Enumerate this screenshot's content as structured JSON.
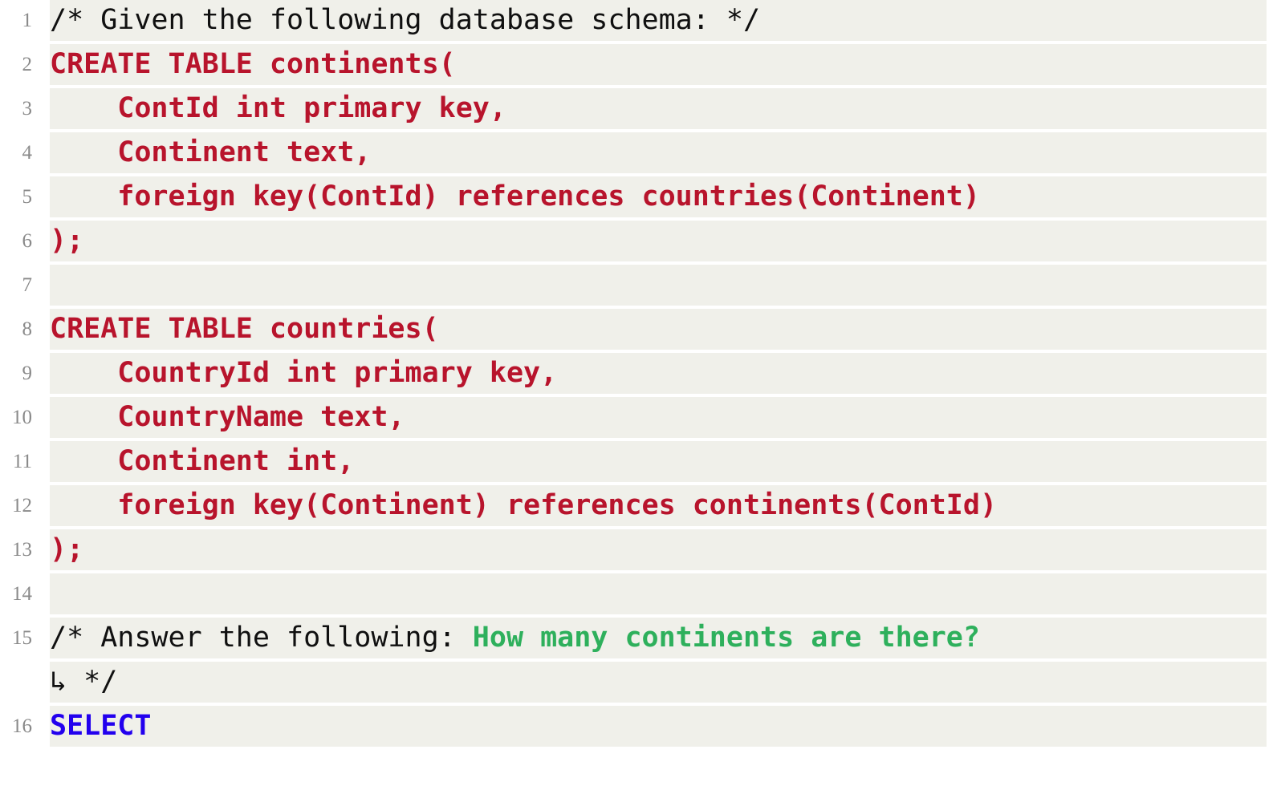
{
  "editor": {
    "name": "sql-code-viewer",
    "background": "#ffffff",
    "line_background": "#f0f0ea",
    "gutter_color": "#8a8a8a",
    "colors": {
      "comment": "#101010",
      "sql_keyword": "#b8142c",
      "question_highlight": "#2eb05c",
      "select_keyword": "#2200ee"
    },
    "wrap_marker": "↳"
  },
  "code": {
    "language": "sql",
    "lines": [
      {
        "number": "1",
        "text": "/* Given the following database schema: */",
        "spans": [
          {
            "text": "/* Given the following database schema: */",
            "style": "comment"
          }
        ]
      },
      {
        "number": "2",
        "text": "CREATE TABLE continents(",
        "spans": [
          {
            "text": "CREATE TABLE continents(",
            "style": "keyword"
          }
        ]
      },
      {
        "number": "3",
        "text": "    ContId int primary key,",
        "spans": [
          {
            "text": "    ContId int primary key,",
            "style": "keyword"
          }
        ]
      },
      {
        "number": "4",
        "text": "    Continent text,",
        "spans": [
          {
            "text": "    Continent text,",
            "style": "keyword"
          }
        ]
      },
      {
        "number": "5",
        "text": "    foreign key(ContId) references countries(Continent)",
        "spans": [
          {
            "text": "    foreign key(ContId) references countries(Continent)",
            "style": "keyword"
          }
        ]
      },
      {
        "number": "6",
        "text": ");",
        "spans": [
          {
            "text": ");",
            "style": "keyword"
          }
        ]
      },
      {
        "number": "7",
        "text": "",
        "spans": []
      },
      {
        "number": "8",
        "text": "CREATE TABLE countries(",
        "spans": [
          {
            "text": "CREATE TABLE countries(",
            "style": "keyword"
          }
        ]
      },
      {
        "number": "9",
        "text": "    CountryId int primary key,",
        "spans": [
          {
            "text": "    CountryId int primary key,",
            "style": "keyword"
          }
        ]
      },
      {
        "number": "10",
        "text": "    CountryName text,",
        "spans": [
          {
            "text": "    CountryName text,",
            "style": "keyword"
          }
        ]
      },
      {
        "number": "11",
        "text": "    Continent int,",
        "spans": [
          {
            "text": "    Continent int,",
            "style": "keyword"
          }
        ]
      },
      {
        "number": "12",
        "text": "    foreign key(Continent) references continents(ContId)",
        "spans": [
          {
            "text": "    foreign key(Continent) references continents(ContId)",
            "style": "keyword"
          }
        ]
      },
      {
        "number": "13",
        "text": ");",
        "spans": [
          {
            "text": ");",
            "style": "keyword"
          }
        ]
      },
      {
        "number": "14",
        "text": "",
        "spans": []
      },
      {
        "number": "15",
        "text": "/* Answer the following: How many continents are there? */",
        "spans": [
          {
            "text": "/* Answer the following: ",
            "style": "comment"
          },
          {
            "text": "How many continents are there?",
            "style": "question"
          }
        ]
      },
      {
        "number": "",
        "wrapped": true,
        "text": "↳ */",
        "spans": [
          {
            "text": "↳ */",
            "style": "wrap"
          }
        ]
      },
      {
        "number": "16",
        "text": "SELECT",
        "spans": [
          {
            "text": "SELECT",
            "style": "select"
          }
        ]
      }
    ]
  }
}
